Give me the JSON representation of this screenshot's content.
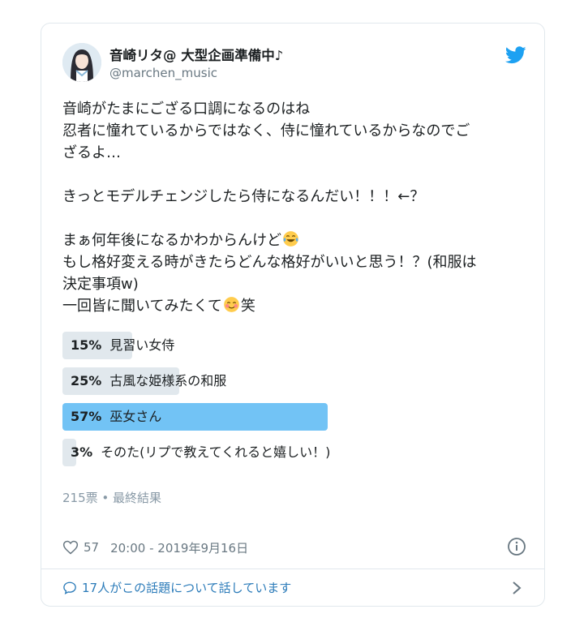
{
  "tweet": {
    "display_name": "音崎リタ@ 大型企画準備中♪",
    "handle": "@marchen_music",
    "text_lines": {
      "l1": "音崎がたまにござる口調になるのはね",
      "l2": "忍者に憧れているからではなく、侍に憧れているからなのでご",
      "l3": "ざるよ…",
      "l4": "きっとモデルチェンジしたら侍になるんだい！！！←？",
      "l5": "まぁ何年後になるかわからんけど",
      "l6": "もし格好変える時がきたらどんな格好がいいと思う！？(和服は",
      "l7": "決定事項w)",
      "l8a": "一回皆に聞いてみたくて",
      "l8b": "笑"
    },
    "emoji": {
      "tears_of_joy": "face-with-tears-of-joy-icon",
      "smiling_blush": "smiling-face-icon"
    }
  },
  "poll": {
    "options": [
      {
        "percent_label": "15%",
        "label": "見習い女侍",
        "percent": 15,
        "winner": false
      },
      {
        "percent_label": "25%",
        "label": "古風な姫様系の和服",
        "percent": 25,
        "winner": false
      },
      {
        "percent_label": "57%",
        "label": "巫女さん",
        "percent": 57,
        "winner": true
      },
      {
        "percent_label": "3%",
        "label": "そのた(リプで教えてくれると嬉しい！)",
        "percent": 3,
        "winner": false
      }
    ],
    "summary": "215票 • 最終結果"
  },
  "footer": {
    "likes": "57",
    "timestamp": "20:00 - 2019年9月16日",
    "conversation": "17人がこの話題について話しています"
  },
  "colors": {
    "winner_bar": "#72c3f5",
    "bar": "#e1e8ed",
    "twitter_blue": "#1da1f2",
    "link": "#2b7bb9"
  },
  "icons": [
    "twitter-bird-icon",
    "heart-icon",
    "info-icon",
    "speech-bubble-icon",
    "chevron-right-icon"
  ]
}
